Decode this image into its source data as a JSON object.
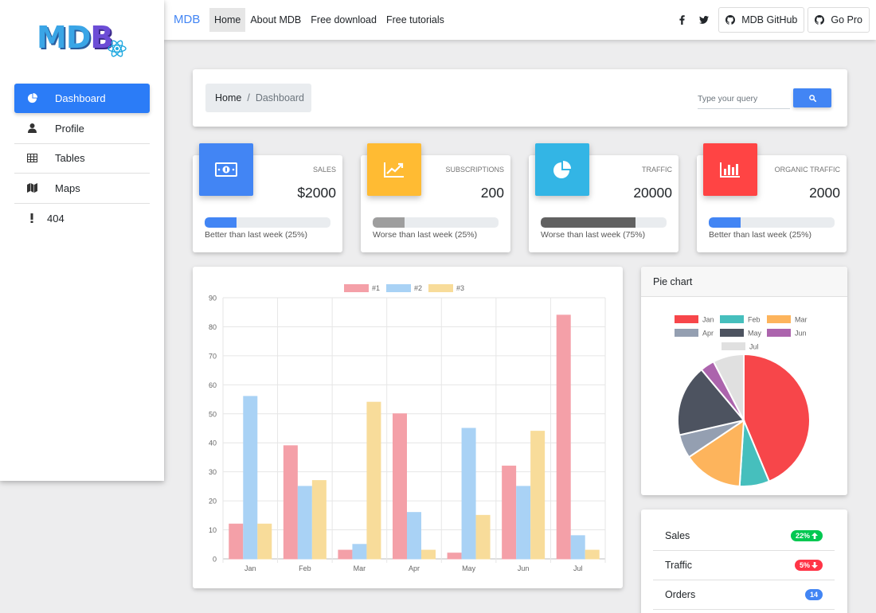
{
  "brand": "MDB",
  "logo": {
    "letters_main": "MD",
    "letters_b": "B"
  },
  "sidebar": {
    "items": [
      {
        "label": "Dashboard",
        "icon": "pie-chart-icon",
        "active": true
      },
      {
        "label": "Profile",
        "icon": "user-icon"
      },
      {
        "label": "Tables",
        "icon": "table-icon"
      },
      {
        "label": "Maps",
        "icon": "map-icon"
      },
      {
        "label": "404",
        "icon": "exclamation-icon"
      }
    ]
  },
  "navbar": {
    "brand": "MDB",
    "links": [
      "Home",
      "About MDB",
      "Free download",
      "Free tutorials"
    ],
    "active_link": "Home",
    "github_label": "MDB GitHub",
    "gopro_label": "Go Pro"
  },
  "breadcrumb": {
    "home": "Home",
    "separator": "/",
    "current": "Dashboard"
  },
  "search": {
    "placeholder": "Type your query"
  },
  "stats": [
    {
      "label": "SALES",
      "value": "$2000",
      "note": "Better than last week (25%)",
      "progress": 0.25,
      "bar_color": "#4285f4",
      "icon_bg": "#4285f4",
      "icon": "money-icon"
    },
    {
      "label": "SUBSCRIPTIONS",
      "value": "200",
      "note": "Worse than last week (25%)",
      "progress": 0.25,
      "bar_color": "#9e9e9e",
      "icon_bg": "#ffbb33",
      "icon": "chart-line-icon"
    },
    {
      "label": "TRAFFIC",
      "value": "20000",
      "note": "Worse than last week (75%)",
      "progress": 0.75,
      "bar_color": "#616161",
      "icon_bg": "#33b5e5",
      "icon": "pie-chart-icon"
    },
    {
      "label": "ORGANIC TRAFFIC",
      "value": "2000",
      "note": "Better than last week (25%)",
      "progress": 0.25,
      "bar_color": "#4285f4",
      "icon_bg": "#ff4444",
      "icon": "bar-chart-icon"
    }
  ],
  "chart_data": [
    {
      "type": "bar",
      "categories": [
        "Jan",
        "Feb",
        "Mar",
        "Apr",
        "May",
        "Jun",
        "Jul"
      ],
      "series": [
        {
          "name": "#1",
          "values": [
            12,
            39,
            3,
            50,
            2,
            32,
            84
          ],
          "color": "#f4a0a8"
        },
        {
          "name": "#2",
          "values": [
            56,
            25,
            5,
            16,
            45,
            25,
            8
          ],
          "color": "#a9d2f5"
        },
        {
          "name": "#3",
          "values": [
            12,
            27,
            54,
            3,
            15,
            44,
            3
          ],
          "color": "#f8dc9a"
        }
      ],
      "ylim": [
        0,
        90
      ],
      "yticks": [
        0,
        10,
        20,
        30,
        40,
        50,
        60,
        70,
        80,
        90
      ],
      "grid": true,
      "legend": "top-center"
    },
    {
      "type": "pie",
      "title": "Pie chart",
      "labels": [
        "Jan",
        "Feb",
        "Mar",
        "Apr",
        "May",
        "Jun",
        "Jul"
      ],
      "values": [
        300,
        50,
        100,
        40,
        120,
        24,
        52
      ],
      "colors": [
        "#f7464a",
        "#46bfbd",
        "#fdb45c",
        "#949fb1",
        "#4d5360",
        "#ac64ad",
        "#e0e0e0"
      ],
      "legend": "top"
    }
  ],
  "list": [
    {
      "label": "Sales",
      "badge": "22%",
      "badge_color": "#00c851",
      "trend": "up"
    },
    {
      "label": "Traffic",
      "badge": "5%",
      "badge_color": "#ff3547",
      "trend": "down"
    },
    {
      "label": "Orders",
      "badge": "14",
      "badge_color": "#4285f4",
      "trend": "none"
    }
  ]
}
